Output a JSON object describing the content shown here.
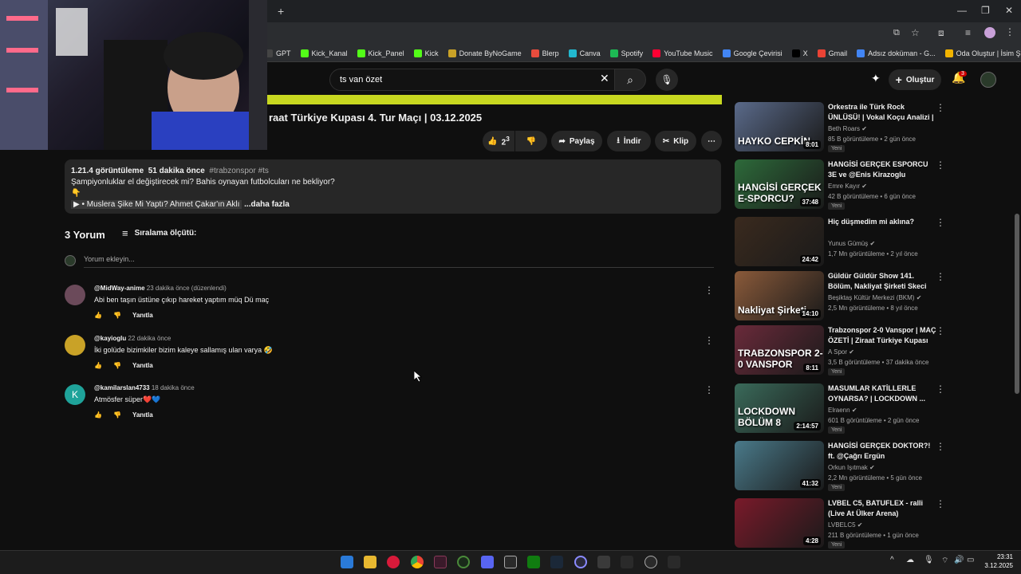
{
  "browser": {
    "new_tab_symbol": "+",
    "bookmarks": [
      {
        "label": "GPT",
        "color": "#444"
      },
      {
        "label": "Kick_Kanal",
        "color": "#53fc18"
      },
      {
        "label": "Kick_Panel",
        "color": "#53fc18"
      },
      {
        "label": "Kick",
        "color": "#53fc18"
      },
      {
        "label": "Donate ByNoGame",
        "color": "#c9a227"
      },
      {
        "label": "Blerp",
        "color": "#e84c3d"
      },
      {
        "label": "Canva",
        "color": "#22b8cf"
      },
      {
        "label": "Spotify",
        "color": "#1db954"
      },
      {
        "label": "YouTube Music",
        "color": "#ff0033"
      },
      {
        "label": "Google Çevirisi",
        "color": "#4285f4"
      },
      {
        "label": "X",
        "color": "#000000"
      },
      {
        "label": "Gmail",
        "color": "#ea4335"
      },
      {
        "label": "Adsız doküman - G...",
        "color": "#4285f4"
      },
      {
        "label": "Oda Oluştur | İsim Ş...",
        "color": "#f2b400"
      }
    ]
  },
  "header": {
    "search_query": "ts van özet",
    "create_label": "Oluştur",
    "notification_count": "3"
  },
  "video": {
    "title": "raat Türkiye Kupası 4. Tur Maçı | 03.12.2025",
    "like_count": "2",
    "like_count_sup": "3",
    "share_label": "Paylaş",
    "download_label": "İndir",
    "clip_label": "Klip",
    "description": {
      "views": "1.21.4 görüntüleme",
      "time": "51 dakika önce",
      "hashtags": "#trabzonspor #ts",
      "line1": "Şampiyonluklar el değiştirecek mi? Bahis oynayan futbolcuları ne bekliyor?",
      "line2": "👇",
      "line3": "▶ • Muslera Şike Mi Yaptı? Ahmet Çakar'ın Aklı",
      "more": "...daha fazla"
    }
  },
  "comments": {
    "count_label": "3 Yorum",
    "sort_label": "Sıralama ölçütü:",
    "add_placeholder": "Yorum ekleyin...",
    "reply_label": "Yanıtla",
    "items": [
      {
        "user": "@MidWay-anime",
        "time": "23 dakika önce (düzenlendi)",
        "text": "Abi ben taşın üstüne çıkıp hareket yaptım müq Dü maç",
        "avatar_color": "#6b4a5a"
      },
      {
        "user": "@kayioglu",
        "time": "22 dakika önce",
        "text": "İki golüde bizimkiler bizim kaleye sallamış ulan varya 🤣",
        "avatar_color": "#c9a227"
      },
      {
        "user": "@kamilarslan4733",
        "time": "18 dakika önce",
        "text": "Atmösfer süper❤️💙",
        "avatar_color": "#1fa39a",
        "avatar_letter": "K"
      }
    ]
  },
  "sidebar": {
    "items": [
      {
        "title": "Orkestra ile Türk Rock ÜNLÜSÜ! | Vokal Koçu Analizi | Hayko ...",
        "channel": "Beth Roars",
        "meta": "85 B görüntüleme • 2 gün önce",
        "badge": "Yeni",
        "duration": "8:01",
        "thumb_text": "HAYKO CEPKİN",
        "thumb_color": "#5a6a8a"
      },
      {
        "title": "HANGİSİ GERÇEK ESPORCU 3E ve @Enis Kirazoglu",
        "channel": "Emre Kayır",
        "meta": "42 B görüntüleme • 6 gün önce",
        "badge": "Yeni",
        "duration": "37:48",
        "thumb_text": "HANGİSİ GERÇEK E-SPORCU?",
        "thumb_color": "#2d6a3a"
      },
      {
        "title": "Hiç düşmedim mi aklına?",
        "channel": "Yunus Gümüş",
        "meta": "1,7 Mn görüntüleme • 2 yıl önce",
        "badge": "",
        "duration": "24:42",
        "thumb_text": "",
        "thumb_color": "#3a2a1e"
      },
      {
        "title": "Güldür Güldür Show 141. Bölüm, Nakliyat Şirketi Skeci",
        "channel": "Beşiktaş Kültür Merkezi (BKM)",
        "meta": "2,5 Mn görüntüleme • 8 yıl önce",
        "badge": "",
        "duration": "14:10",
        "thumb_text": "Nakliyat Şirketi",
        "thumb_color": "#8a5a3a"
      },
      {
        "title": "Trabzonspor 2-0 Vanspor | MAÇ ÖZETİ | Ziraat Türkiye Kupası 4...",
        "channel": "A Spor",
        "meta": "3,5 B görüntüleme • 37 dakika önce",
        "badge": "Yeni",
        "duration": "8:11",
        "thumb_text": "TRABZONSPOR 2-0 VANSPOR",
        "thumb_color": "#6a2a3a"
      },
      {
        "title": "MASUMLAR KATİLLERLE OYNARSA? | LOCKDOWN ...",
        "channel": "Elraenn",
        "meta": "601 B görüntüleme • 2 gün önce",
        "badge": "Yeni",
        "duration": "2:14:57",
        "thumb_text": "LOCKDOWN BÖLÜM 8",
        "thumb_color": "#3a6a5a"
      },
      {
        "title": "HANGİSİ GERÇEK DOKTOR?! ft. @Çağrı Ergün",
        "channel": "Orkun Işıtmak",
        "meta": "2,2 Mn görüntüleme • 5 gün önce",
        "badge": "Yeni",
        "duration": "41:32",
        "thumb_text": "",
        "thumb_color": "#4a7a8a"
      },
      {
        "title": "LVBEL C5, BATUFLEX - ralli (Live At Ülker Arena)",
        "channel": "LVBELC5",
        "meta": "211 B görüntüleme • 1 gün önce",
        "badge": "Yeni",
        "duration": "4:28",
        "thumb_text": "",
        "thumb_color": "#7a1a2a"
      }
    ]
  },
  "taskbar": {
    "time": "23:31",
    "date": "3.12.2025"
  }
}
